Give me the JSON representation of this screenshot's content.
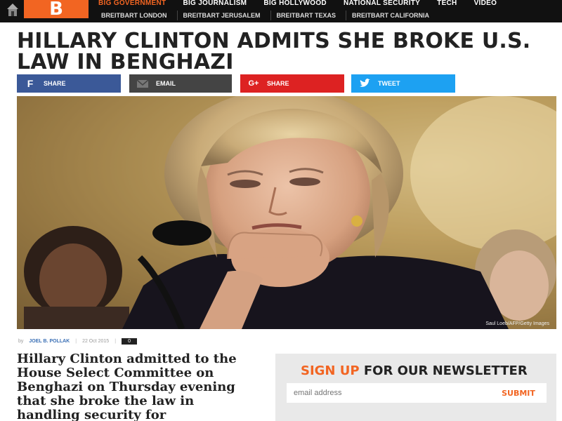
{
  "nav": {
    "logo_letter": "B",
    "primary": [
      "Big Government",
      "Big Journalism",
      "Big Hollywood",
      "National Security",
      "Tech",
      "Video"
    ],
    "secondary": [
      "Breitbart London",
      "Breitbart Jerusalem",
      "Breitbart Texas",
      "Breitbart California"
    ]
  },
  "article": {
    "headline": "Hillary Clinton Admits She Broke U.S. Law in Benghazi",
    "share": {
      "facebook": "Share",
      "email": "Email",
      "googleplus": "Share",
      "twitter": "Tweet"
    },
    "photo_credit": "Saul Loeb/AFP/Getty Images",
    "byline": {
      "prefix": "by",
      "author": "Joel B. Pollak",
      "date": "22 Oct 2015",
      "comments": "0"
    },
    "lede": "Hillary Clinton admitted to the House Select Committee on Benghazi on Thursday evening that she broke the law in handling security for"
  },
  "newsletter": {
    "title_highlight": "Sign Up",
    "title_rest": " for our newsletter",
    "placeholder": "email address",
    "submit": "Submit"
  },
  "colors": {
    "brand_orange": "#f26522",
    "facebook": "#3b5998",
    "email": "#444444",
    "googleplus": "#dd2222",
    "twitter": "#1da1f2",
    "author_link": "#3a6fb5"
  },
  "icons": {
    "home": "house-icon",
    "facebook": "facebook-icon",
    "email": "envelope-icon",
    "googleplus": "google-plus-icon",
    "twitter": "twitter-bird-icon",
    "comments": "comment-bubble-icon"
  }
}
